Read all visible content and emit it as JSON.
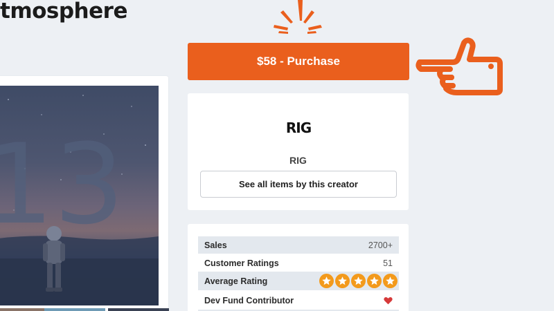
{
  "item": {
    "title": "tmosphere"
  },
  "purchase": {
    "label": "$58 - Purchase"
  },
  "creator": {
    "logo_text": "RIG",
    "name": "RIG",
    "see_all_label": "See all items by this creator"
  },
  "preview": {
    "number_overlay": "13",
    "thumbnail_colors": [
      "#8a7468",
      "#6f9bb5",
      "#3a4254"
    ]
  },
  "stats": {
    "sales_label": "Sales",
    "sales_value": "2700+",
    "ratings_label": "Customer Ratings",
    "ratings_value": "51",
    "avg_label": "Average Rating",
    "avg_stars": 5,
    "avg_max": 5,
    "dev_label": "Dev Fund Contributor",
    "dev_icon": "heart-icon"
  },
  "colors": {
    "accent": "#ea5f1d",
    "star": "#f39a1c",
    "heart": "#d63a3a"
  }
}
